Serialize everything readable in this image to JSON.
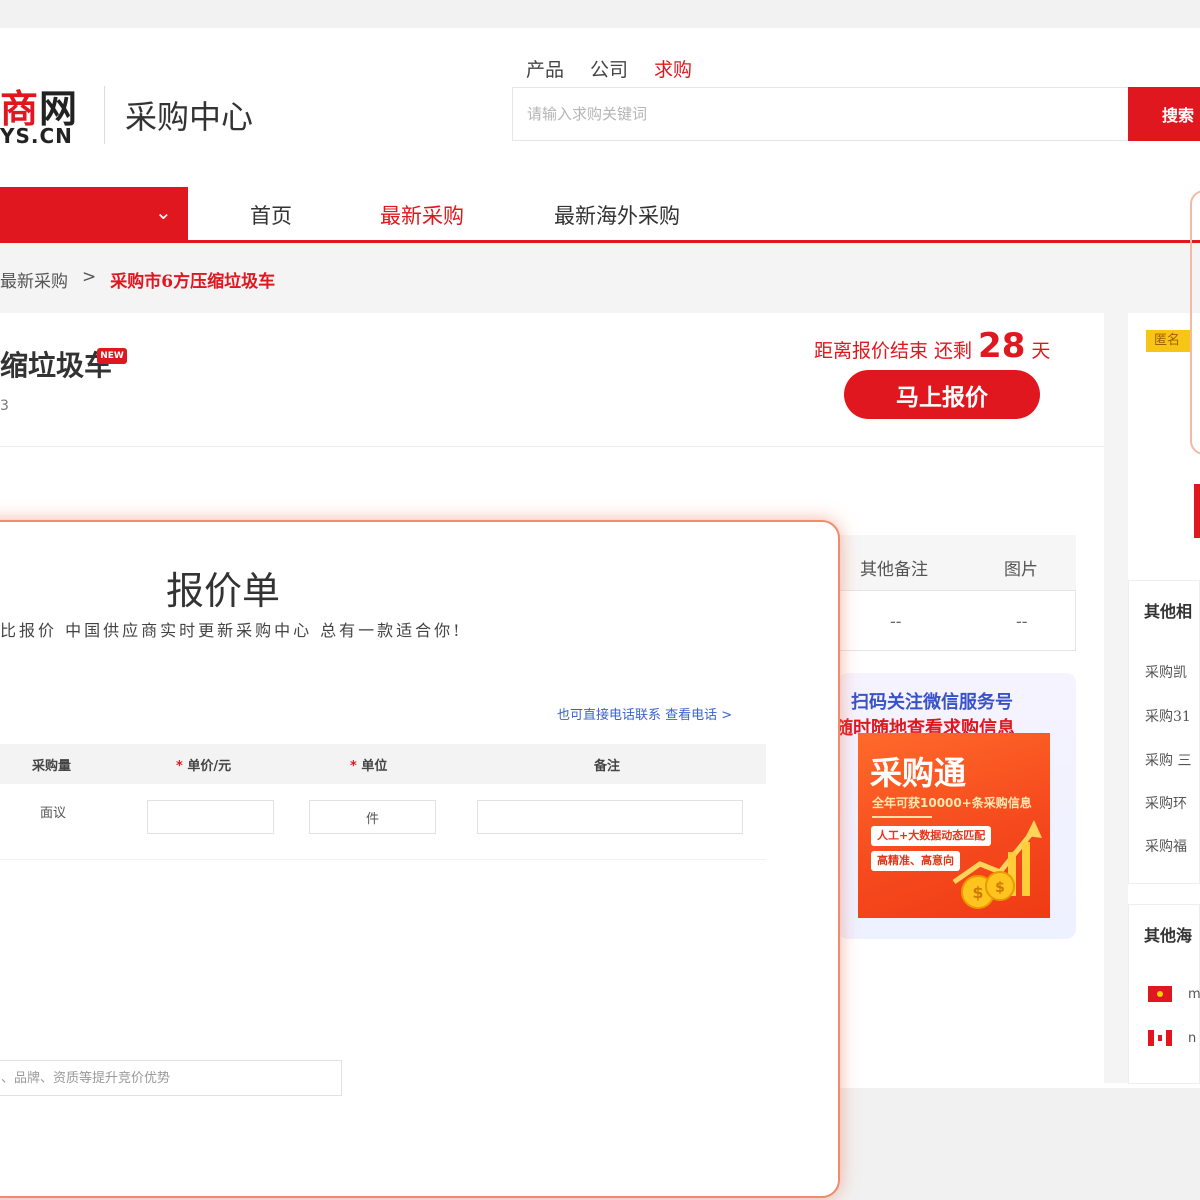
{
  "header": {
    "logo_cn_red": "商",
    "logo_cn_dark": "网",
    "logo_en": "YS.CN",
    "site_title": "采购中心",
    "search_tabs": [
      "产品",
      "公司",
      "求购"
    ],
    "search_placeholder": "请输入求购关键词",
    "search_button": "搜索"
  },
  "nav": {
    "chevron": "⌄",
    "items": [
      "首页",
      "最新采购",
      "最新海外采购"
    ]
  },
  "breadcrumb": {
    "items": [
      "最新采购",
      ">",
      "采购市6方压缩垃圾车"
    ]
  },
  "product": {
    "title": "缩垃圾车",
    "new_badge": "NEW",
    "sub": "3",
    "deadline_prefix": "距离报价结束 还剩",
    "days_left": "28",
    "days_unit": "天",
    "quote_button": "马上报价"
  },
  "detail_table": {
    "headers": [
      "其他备注",
      "图片"
    ],
    "cells": [
      "--",
      "--"
    ]
  },
  "qr_card": {
    "title": "扫码关注微信服务号",
    "sub": "随时随地查看求购信息",
    "ad_title": "采购通",
    "ad_line": "全年可获10000+条采购信息",
    "ad_tag1": "人工+大数据动态匹配",
    "ad_tag2": "高精准、高意向"
  },
  "sidebar": {
    "anon_badge": "匿名",
    "heading1": "其他相",
    "links": [
      "采购凯",
      "采购31",
      "采购 三",
      "采购环",
      "采购福"
    ],
    "heading2": "其他海",
    "flags": [
      {
        "text": "m",
        "color": "#e0171e"
      },
      {
        "text": "n",
        "color": "#e0171e"
      }
    ]
  },
  "quote_modal": {
    "title": "报价单",
    "slogan": "比报价 中国供应商实时更新采购中心 总有一款适合你!",
    "phone_link": "也可直接电话联系 查看电话 >",
    "columns": [
      "采购量",
      "单价/元",
      "单位",
      "备注"
    ],
    "required_mark": "*",
    "row": {
      "qty": "面议",
      "unit_price": "",
      "unit": "件",
      "remark": ""
    },
    "remark_placeholder": "、品牌、资质等提升竞价优势"
  }
}
